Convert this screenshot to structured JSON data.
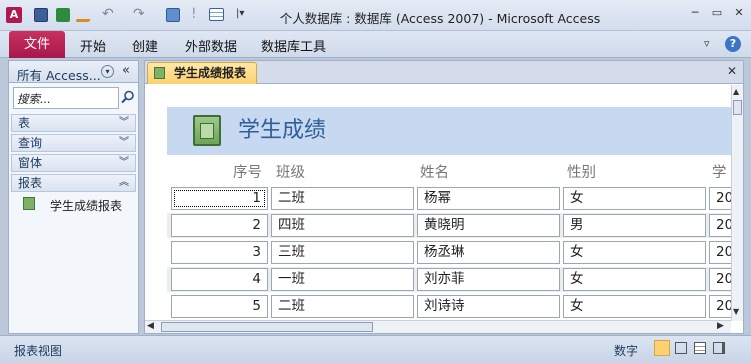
{
  "window": {
    "title": "个人数据库 : 数据库 (Access 2007)  -  Microsoft Access"
  },
  "ribbon": {
    "file": "文件",
    "tabs": [
      "开始",
      "创建",
      "外部数据",
      "数据库工具"
    ]
  },
  "nav": {
    "title": "所有 Access...",
    "search_placeholder": "搜索...",
    "groups": [
      {
        "label": "表",
        "expanded": false
      },
      {
        "label": "查询",
        "expanded": false
      },
      {
        "label": "窗体",
        "expanded": false
      },
      {
        "label": "报表",
        "expanded": true
      }
    ],
    "report_item": "学生成绩报表"
  },
  "document": {
    "tab_label": "学生成绩报表",
    "report_title": "学生成绩",
    "columns": [
      "序号",
      "班级",
      "姓名",
      "性别",
      "学"
    ],
    "rows": [
      {
        "id": "1",
        "class": "二班",
        "name": "杨幂",
        "gender": "女",
        "extra": "20"
      },
      {
        "id": "2",
        "class": "四班",
        "name": "黄晓明",
        "gender": "男",
        "extra": "20"
      },
      {
        "id": "3",
        "class": "三班",
        "name": "杨丞琳",
        "gender": "女",
        "extra": "20"
      },
      {
        "id": "4",
        "class": "一班",
        "name": "刘亦菲",
        "gender": "女",
        "extra": "20"
      },
      {
        "id": "5",
        "class": "二班",
        "name": "刘诗诗",
        "gender": "女",
        "extra": "20"
      }
    ]
  },
  "status": {
    "left": "报表视图",
    "mode": "数字"
  },
  "colors": {
    "file_tab": "#b0184e",
    "report_header": "#c6d9f1",
    "report_title": "#2e5f96",
    "doc_tab": "#fcd171"
  }
}
